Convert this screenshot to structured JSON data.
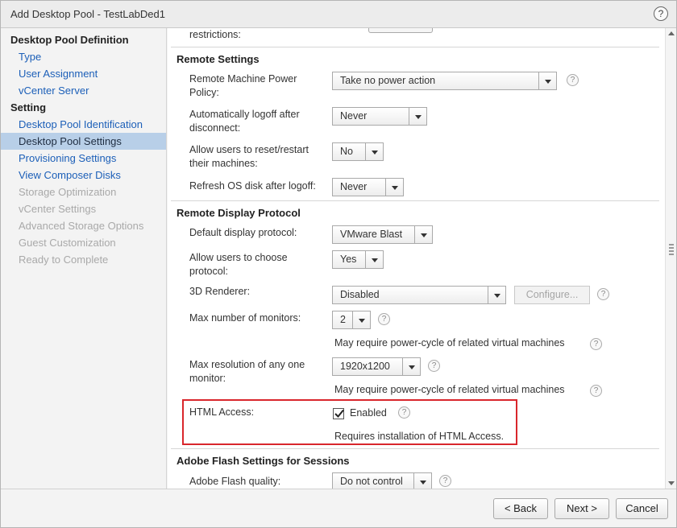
{
  "window": {
    "title": "Add Desktop Pool - TestLabDed1",
    "help": "?"
  },
  "sidebar": {
    "items": [
      {
        "label": "Desktop Pool Definition",
        "kind": "head"
      },
      {
        "label": "Type",
        "kind": "link"
      },
      {
        "label": "User Assignment",
        "kind": "link"
      },
      {
        "label": "vCenter Server",
        "kind": "link"
      },
      {
        "label": "Setting",
        "kind": "head"
      },
      {
        "label": "Desktop Pool Identification",
        "kind": "link"
      },
      {
        "label": "Desktop Pool Settings",
        "kind": "selected"
      },
      {
        "label": "Provisioning Settings",
        "kind": "link"
      },
      {
        "label": "View Composer Disks",
        "kind": "link"
      },
      {
        "label": "Storage Optimization",
        "kind": "disabled"
      },
      {
        "label": "vCenter Settings",
        "kind": "disabled"
      },
      {
        "label": "Advanced Storage Options",
        "kind": "disabled"
      },
      {
        "label": "Guest Customization",
        "kind": "disabled"
      },
      {
        "label": "Ready to Complete",
        "kind": "disabled"
      }
    ]
  },
  "content": {
    "top_partial_label": "restrictions:",
    "remote_settings": {
      "title": "Remote Settings",
      "power_policy": {
        "label": "Remote Machine Power Policy:",
        "value": "Take no power action"
      },
      "auto_logoff": {
        "label": "Automatically logoff after disconnect:",
        "value": "Never"
      },
      "allow_reset": {
        "label": "Allow users to reset/restart their machines:",
        "value": "No"
      },
      "refresh_os": {
        "label": "Refresh OS disk after logoff:",
        "value": "Never"
      }
    },
    "remote_display": {
      "title": "Remote Display Protocol",
      "default_protocol": {
        "label": "Default display protocol:",
        "value": "VMware Blast"
      },
      "allow_choose": {
        "label": "Allow users to choose protocol:",
        "value": "Yes"
      },
      "renderer": {
        "label": "3D Renderer:",
        "value": "Disabled",
        "configure_label": "Configure..."
      },
      "max_monitors": {
        "label": "Max number of monitors:",
        "value": "2",
        "note": "May require power-cycle of related virtual machines"
      },
      "max_resolution": {
        "label": "Max resolution of any one monitor:",
        "value": "1920x1200",
        "note": "May require power-cycle of related virtual machines"
      },
      "html_access": {
        "label": "HTML Access:",
        "checkbox_label": "Enabled",
        "checked": true,
        "note": "Requires installation of HTML Access."
      }
    },
    "adobe_flash": {
      "title": "Adobe Flash Settings for Sessions",
      "quality": {
        "label": "Adobe Flash quality:",
        "value": "Do not control"
      }
    },
    "help_glyph": "?"
  },
  "footer": {
    "back_label": "< Back",
    "next_label": "Next >",
    "cancel_label": "Cancel"
  },
  "colors": {
    "highlight": "#d9262c",
    "link": "#1c5fb8",
    "selected_bg": "#b8cfe8"
  }
}
